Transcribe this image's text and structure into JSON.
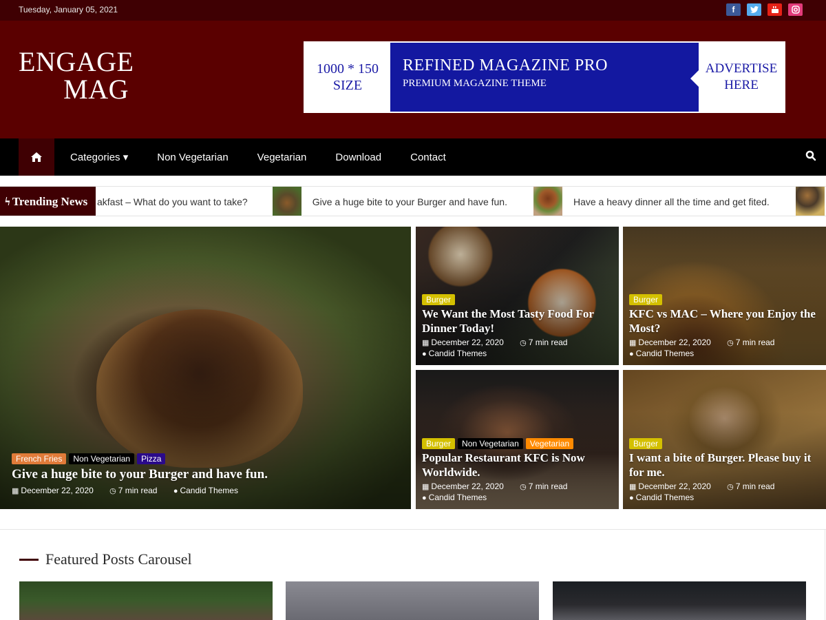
{
  "topbar": {
    "date": "Tuesday, January 05, 2021",
    "social": [
      {
        "name": "facebook-icon",
        "glyph": "f"
      },
      {
        "name": "twitter-icon",
        "glyph": "t"
      },
      {
        "name": "youtube-icon",
        "glyph": "▶"
      },
      {
        "name": "instagram-icon",
        "glyph": "◎"
      }
    ]
  },
  "header": {
    "logo_line1": "ENGAGE",
    "logo_line2": "MAG",
    "ad": {
      "left_line1": "1000 * 150",
      "left_line2": "SIZE",
      "title": "REFINED MAGAZINE PRO",
      "subtitle": "PREMIUM MAGAZINE THEME",
      "right_line1": "ADVERTISE",
      "right_line2": "HERE"
    }
  },
  "nav": {
    "home_icon": "⌂",
    "items": [
      "Categories ▾",
      "Non Vegetarian",
      "Vegetarian",
      "Download",
      "Contact"
    ],
    "search_icon": "search-icon"
  },
  "trending": {
    "label": "Trending News",
    "bolt": "ϟ",
    "items": [
      "akfast – What do you want to take?",
      "Give a huge bite to your Burger and have fun.",
      "Have a heavy dinner all the time and get fited."
    ]
  },
  "colors": {
    "brand_dark": "#3f0003",
    "header_bg": "#5a0000",
    "cat_burger": "#d4c000",
    "cat_french_fries": "#e07b39",
    "cat_non_veg": "#000000",
    "cat_pizza": "#2a0a8a",
    "cat_vegetarian": "#ff8a00"
  },
  "posts": {
    "big": {
      "categories": [
        "French Fries",
        "Non Vegetarian",
        "Pizza"
      ],
      "title": "Give a huge bite to your Burger and have fun.",
      "date": "December 22, 2020",
      "read": "7 min read",
      "author": "Candid Themes"
    },
    "s1": {
      "categories": [
        "Burger"
      ],
      "title": "We Want the Most Tasty Food For Dinner Today!",
      "date": "December 22, 2020",
      "read": "7 min read",
      "author": "Candid Themes"
    },
    "s2": {
      "categories": [
        "Burger"
      ],
      "title": "KFC vs MAC – Where you Enjoy the Most?",
      "date": "December 22, 2020",
      "read": "7 min read",
      "author": "Candid Themes"
    },
    "s3": {
      "categories": [
        "Burger",
        "Non Vegetarian",
        "Vegetarian"
      ],
      "title": "Popular Restaurant KFC is Now Worldwide.",
      "date": "December 22, 2020",
      "read": "7 min read",
      "author": "Candid Themes"
    },
    "s4": {
      "categories": [
        "Burger"
      ],
      "title": "I want a bite of Burger. Please buy it for me.",
      "date": "December 22, 2020",
      "read": "7 min read",
      "author": "Candid Themes"
    }
  },
  "featured": {
    "title": "Featured Posts Carousel"
  }
}
